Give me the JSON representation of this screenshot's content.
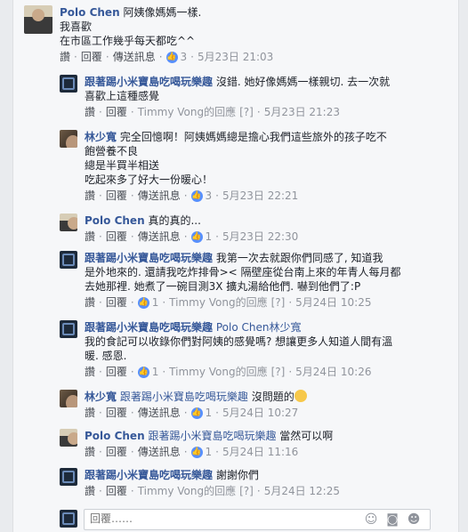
{
  "labels": {
    "like": "讚",
    "reply": "回覆",
    "translate": "傳送訊息",
    "reply_placeholder": "回覆……",
    "dot": "·",
    "edited": "[?]"
  },
  "comments": [
    {
      "author": "Polo Chen",
      "lines": [
        "阿姨像媽媽一樣.",
        "我喜歡",
        "在市區工作幾乎每天都吃^^"
      ],
      "likes": "3",
      "time": "5月23日 21:03",
      "sub": false
    },
    {
      "author": "跟著踢小米寶島吃喝玩樂趣",
      "lines": [
        "沒錯. 她好像媽媽一樣親切. 去一次就",
        "喜歡上這種感覺"
      ],
      "responder": "Timmy Vong的回應",
      "time": "5月23日 21:23",
      "sub": true
    },
    {
      "author": "林少寬",
      "lines": [
        "完全回憶啊！阿姨媽媽總是擔心我們這些旅外的孩子吃不",
        "飽營養不良",
        "總是半買半相送",
        "吃起來多了好大一份暖心！"
      ],
      "likes": "3",
      "time": "5月23日 22:21",
      "sub": true
    },
    {
      "author": "Polo Chen",
      "lines": [
        "真的真的..."
      ],
      "likes": "1",
      "time": "5月23日 22:30",
      "sub": true
    },
    {
      "author": "跟著踢小米寶島吃喝玩樂趣",
      "lines": [
        "我第一次去就跟你們同感了, 知道我",
        "是外地來的. 還請我吃炸排骨>< 隔壁座從台南上來的年青人每月都",
        "去她那裡. 她煮了一碗目測3X 擴丸湯給他們. 嚇到他們了:P"
      ],
      "likes": "1",
      "responder": "Timmy Vong的回應",
      "time": "5月24日 10:25",
      "sub": true
    },
    {
      "author": "跟著踢小米寶島吃喝玩樂趣",
      "mention": "Polo Chen林少寬",
      "lines": [
        "我的食記可以收錄你們對阿姨的感覺嗎? 想讓更多人知道人間有溫",
        "暖. 感恩."
      ],
      "likes": "1",
      "responder": "Timmy Vong的回應",
      "time": "5月24日 10:26",
      "sub": true
    },
    {
      "author": "林少寬",
      "mention": "跟著踢小米寶島吃喝玩樂趣",
      "lines": [
        "沒問題的"
      ],
      "likes": "1",
      "time": "5月24日 10:27",
      "sub": true
    },
    {
      "author": "Polo Chen",
      "mention": "跟著踢小米寶島吃喝玩樂趣",
      "lines": [
        "當然可以啊"
      ],
      "likes": "1",
      "time": "5月24日 11:16",
      "sub": true
    },
    {
      "author": "跟著踢小米寶島吃喝玩樂趣",
      "lines": [
        "謝謝你們"
      ],
      "responder": "Timmy Vong的回應",
      "time": "5月24日 12:25",
      "sub": true
    }
  ]
}
